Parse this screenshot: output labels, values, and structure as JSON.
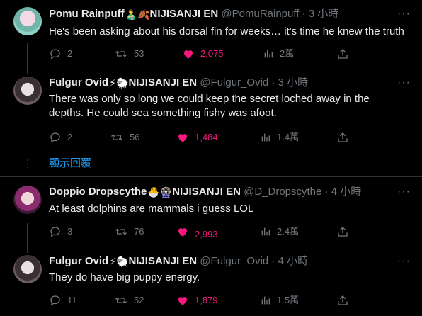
{
  "tweets": [
    {
      "name": "Pomu Rainpuff",
      "badges": "👨‍🍼🍂",
      "org": "NIJISANJI EN",
      "handle": "@PomuRainpuff",
      "time": "· 3 小時",
      "text": "He's been asking about his dorsal fin for weeks… it's time he knew the truth",
      "replies": "2",
      "retweets": "53",
      "likes": "2,075",
      "views": "2萬"
    },
    {
      "name": "Fulgur Ovid",
      "badges": "⚡🐑",
      "org": "NIJISANJI EN",
      "handle": "@Fulgur_Ovid",
      "time": "· 3 小時",
      "text": "There was only so long we could keep the secret loched away in the depths. He could sea something fishy was afoot.",
      "replies": "2",
      "retweets": "56",
      "likes": "1,484",
      "views": "1.4萬"
    },
    {
      "name": "Doppio Dropscythe",
      "badges": "🐣🎡",
      "org": "NIJISANJI EN",
      "handle": "@D_Dropscythe",
      "time": "· 4 小時",
      "text": "At least dolphins are mammals i guess LOL",
      "replies": "3",
      "retweets": "76",
      "likes": "2,993",
      "views": "2.4萬"
    },
    {
      "name": "Fulgur Ovid",
      "badges": "⚡🐑",
      "org": "NIJISANJI EN",
      "handle": "@Fulgur_Ovid",
      "time": "· 4 小時",
      "text": "They do have big puppy energy.",
      "replies": "11",
      "retweets": "52",
      "likes": "1,879",
      "views": "1.5萬"
    }
  ],
  "show_replies": "顯示回覆",
  "more_icon": "···",
  "colors": {
    "background": "#000000",
    "like": "#f91880",
    "link": "#1d9bf0",
    "muted": "#71767b"
  }
}
